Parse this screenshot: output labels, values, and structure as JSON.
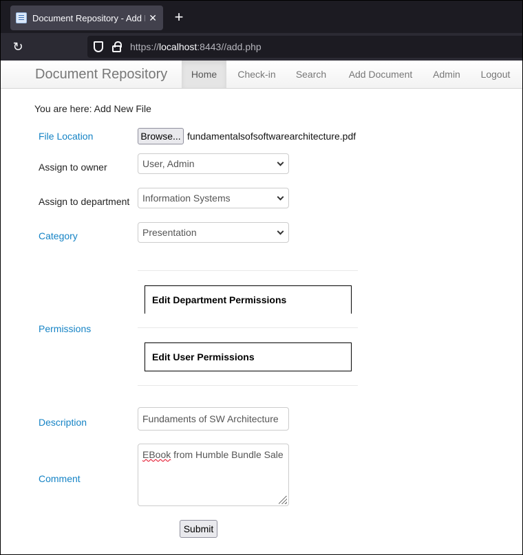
{
  "browser": {
    "tab_title": "Document Repository - Add Ne",
    "tab_close": "✕",
    "new_tab": "+",
    "reload": "↻",
    "url_prefix": "https://",
    "url_host": "localhost",
    "url_rest": ":8443//add.php"
  },
  "navbar": {
    "brand": "Document Repository",
    "items": [
      {
        "label": "Home",
        "active": true
      },
      {
        "label": "Check-in"
      },
      {
        "label": "Search"
      },
      {
        "label": "Add Document"
      },
      {
        "label": "Admin"
      },
      {
        "label": "Logout"
      }
    ]
  },
  "breadcrumb": "You are here: Add New File",
  "form": {
    "file_location_label": "File Location",
    "browse_label": "Browse...",
    "file_name": "fundamentalsofsoftwarearchitecture.pdf",
    "owner_label": "Assign to owner",
    "owner_value": "User, Admin",
    "department_label": "Assign to department",
    "department_value": "Information Systems",
    "category_label": "Category",
    "category_value": "Presentation",
    "permissions_label": "Permissions",
    "edit_department_permissions": "Edit Department Permissions",
    "edit_user_permissions": "Edit User Permissions",
    "description_label": "Description",
    "description_value": "Fundaments of SW Architecture",
    "comment_label": "Comment",
    "comment_value_misspelled": "EBook",
    "comment_value_rest": " from Humble Bundle Sale",
    "submit_label": "Submit"
  },
  "colors": {
    "label_blue": "#1583c5",
    "tab_bar": "#1c1b22",
    "url_bar": "#2b2a33"
  }
}
